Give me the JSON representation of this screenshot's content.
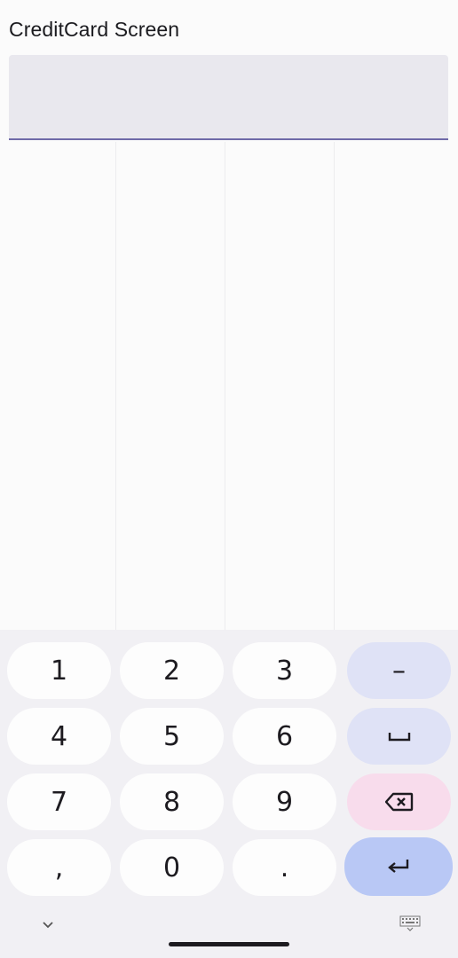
{
  "screen": {
    "title": "CreditCard Screen"
  },
  "card_input": {
    "value": "",
    "placeholder": ""
  },
  "keyboard": {
    "rows": [
      [
        "1",
        "2",
        "3",
        "–"
      ],
      [
        "4",
        "5",
        "6",
        "space"
      ],
      [
        "7",
        "8",
        "9",
        "backspace"
      ],
      [
        ",",
        "0",
        ".",
        "enter"
      ]
    ],
    "keys": {
      "k1": "1",
      "k2": "2",
      "k3": "3",
      "dash": "–",
      "k4": "4",
      "k5": "5",
      "k6": "6",
      "k7": "7",
      "k8": "8",
      "k9": "9",
      "comma": ",",
      "k0": "0",
      "period": "."
    },
    "icons": {
      "space": "space-bar-icon",
      "backspace": "backspace-icon",
      "enter": "enter-arrow-icon"
    }
  },
  "navigation": {
    "icons": [
      "chevron-down-icon",
      "home-handle",
      "keyboard-icon"
    ]
  },
  "colors": {
    "input_underline": "#6f6aa8",
    "function_key": "#dfe2f6",
    "delete_key": "#f8dcec",
    "enter_key": "#b9c8f5"
  }
}
